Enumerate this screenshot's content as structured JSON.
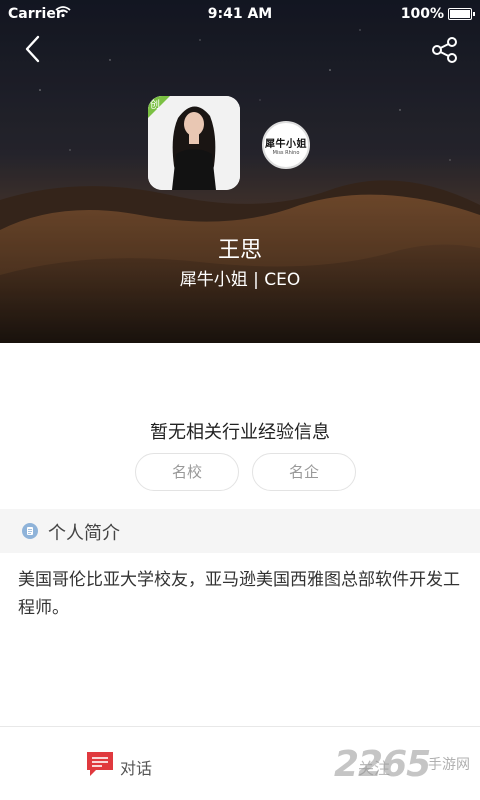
{
  "status_bar": {
    "carrier": "Carrier",
    "time": "9:41 AM",
    "battery": "100%"
  },
  "profile": {
    "name": "王思",
    "title": "犀牛小姐 | CEO",
    "avatar_badge": "创",
    "company_logo_text": "犀牛小姐",
    "company_logo_sub": "Miss Rhino"
  },
  "experience": {
    "empty_text": "暂无相关行业经验信息",
    "tags": [
      "名校",
      "名企"
    ]
  },
  "intro_section": {
    "title": "个人简介",
    "body": "美国哥伦比亚大学校友，亚马逊美国西雅图总部软件开发工程师。"
  },
  "tabbar": {
    "chat_label": "对话",
    "follow_label": "关注"
  },
  "watermark": {
    "number": "2265",
    "text": "手游网"
  },
  "colors": {
    "badge_green": "#7bc043",
    "chat_red": "#e0393e"
  }
}
